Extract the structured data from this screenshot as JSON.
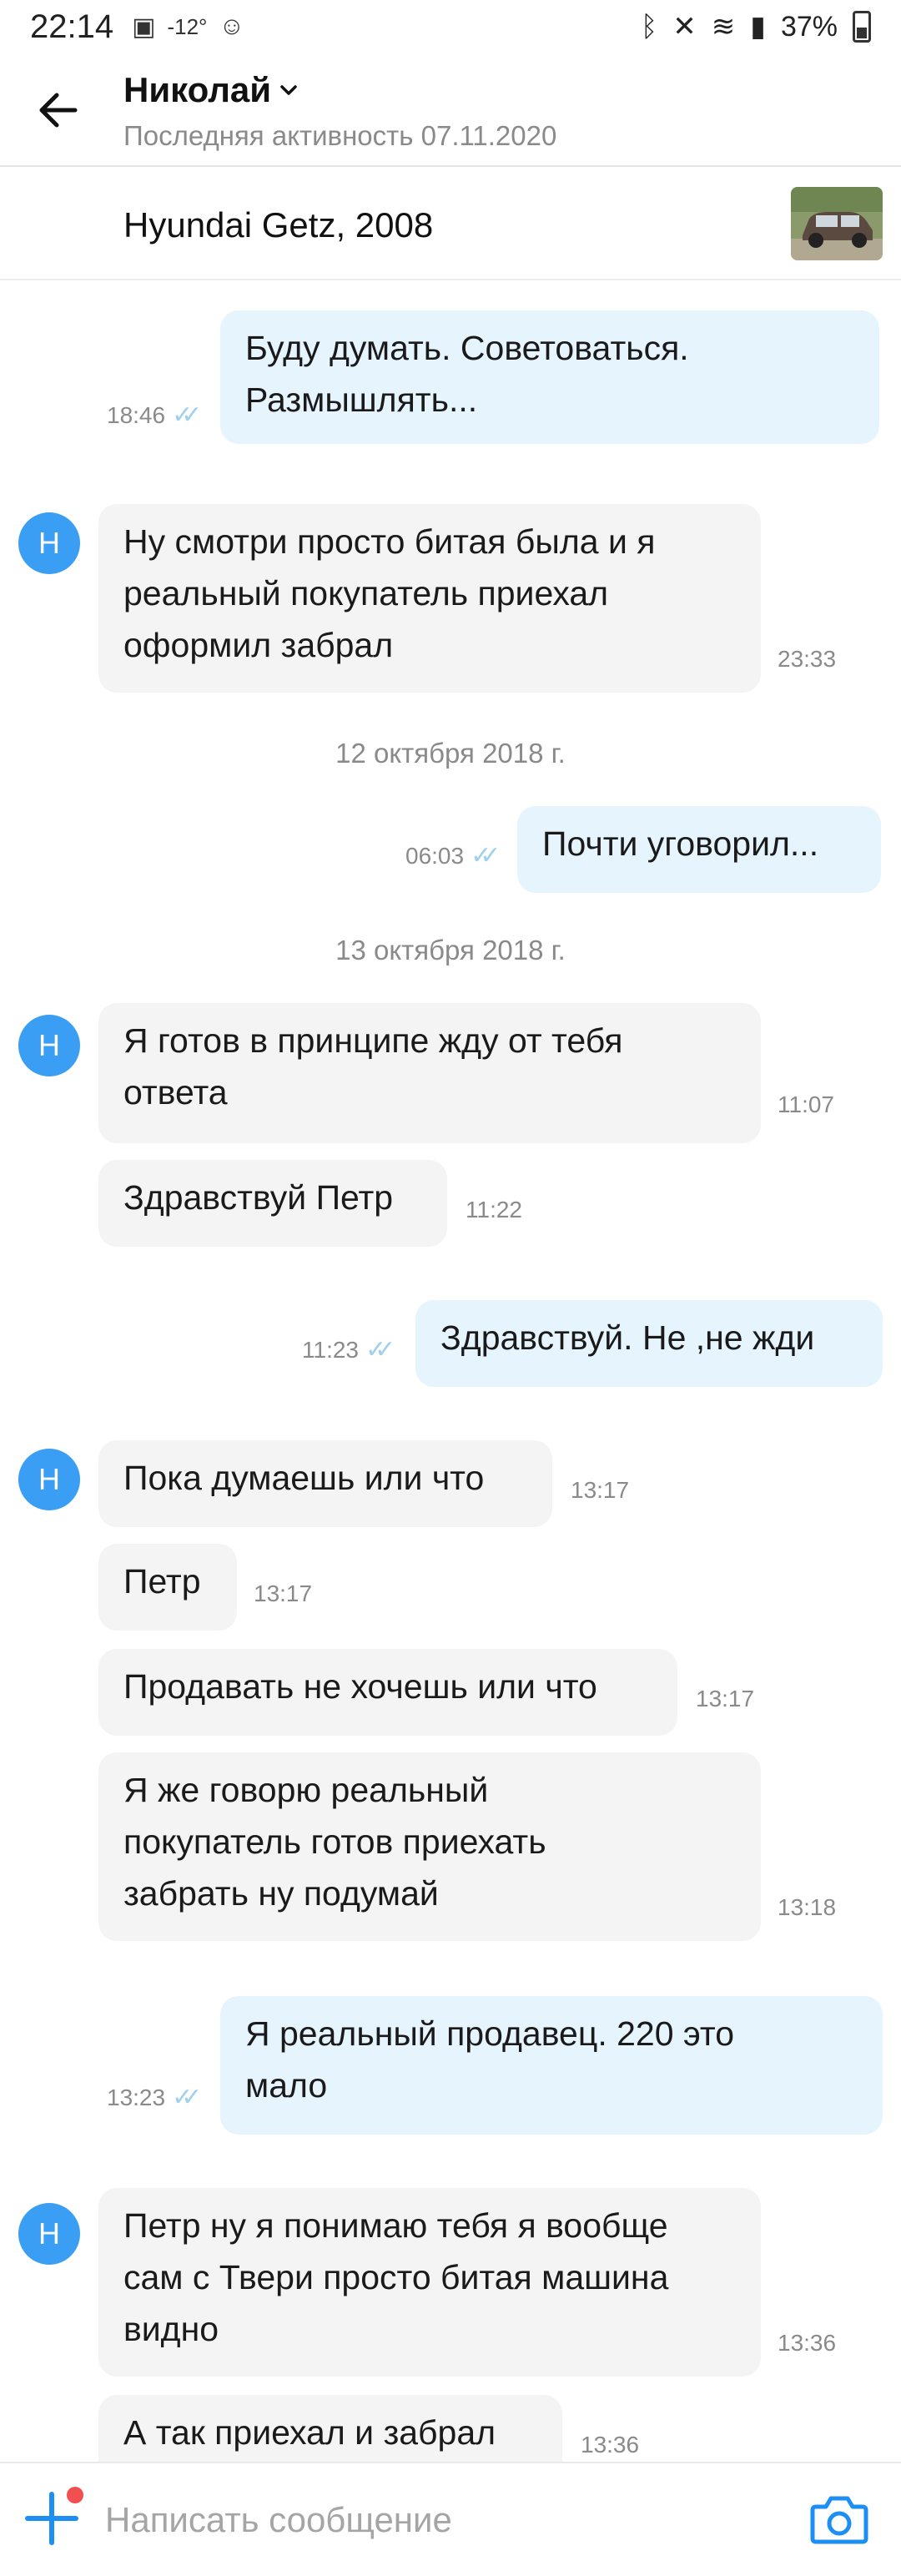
{
  "status_bar": {
    "time": "22:14",
    "temperature": "-12°",
    "battery": "37%"
  },
  "header": {
    "contact_name": "Николай",
    "last_seen": "Последняя активность 07.11.2020"
  },
  "listing": {
    "title": "Hyundai Getz, 2008"
  },
  "avatar_letter": "Н",
  "dates": [
    "12 октября 2018 г.",
    "13 октября 2018 г."
  ],
  "messages": [
    {
      "dir": "out",
      "lines": [
        "Буду думать. Советоваться.",
        "Размышлять..."
      ],
      "time": "18:46"
    },
    {
      "dir": "in",
      "lines": [
        "Ну смотри просто битая была и я",
        "реальный покупатель приехал",
        "оформил забрал"
      ],
      "time": "23:33"
    },
    {
      "dir": "out",
      "lines": [
        "Почти уговорил..."
      ],
      "time": "06:03"
    },
    {
      "dir": "in",
      "lines": [
        "Я готов в принципе жду от тебя",
        "ответа"
      ],
      "time": "11:07"
    },
    {
      "dir": "in",
      "lines": [
        "Здравствуй Петр"
      ],
      "time": "11:22"
    },
    {
      "dir": "out",
      "lines": [
        "Здравствуй. Не ,не жди"
      ],
      "time": "11:23"
    },
    {
      "dir": "in",
      "lines": [
        "Пока думаешь или что"
      ],
      "time": "13:17"
    },
    {
      "dir": "in",
      "lines": [
        "Петр"
      ],
      "time": "13:17"
    },
    {
      "dir": "in",
      "lines": [
        "Продавать не хочешь или что"
      ],
      "time": "13:17"
    },
    {
      "dir": "in",
      "lines": [
        "Я же говорю реальный",
        "покупатель готов приехать",
        "забрать ну подумай"
      ],
      "time": "13:18"
    },
    {
      "dir": "out",
      "lines": [
        "Я реальный продавец. 220 это",
        "мало"
      ],
      "time": "13:23"
    },
    {
      "dir": "in",
      "lines": [
        "Петр ну я понимаю тебя я вообще",
        "сам с Твери просто битая машина",
        "видно"
      ],
      "time": "13:36"
    },
    {
      "dir": "in",
      "lines": [
        "А так приехал и забрал"
      ],
      "time": "13:36"
    }
  ],
  "composer": {
    "placeholder": "Написать сообщение"
  },
  "icons": {
    "back": "arrow-left-icon",
    "add": "plus-icon",
    "camera": "camera-icon"
  },
  "colors": {
    "accent": "#1e8ff2",
    "incoming_bubble": "#f4f4f4",
    "outgoing_bubble": "#e6f4fd",
    "avatar": "#3a9ef4",
    "read_ticks": "#9fd0ee"
  }
}
